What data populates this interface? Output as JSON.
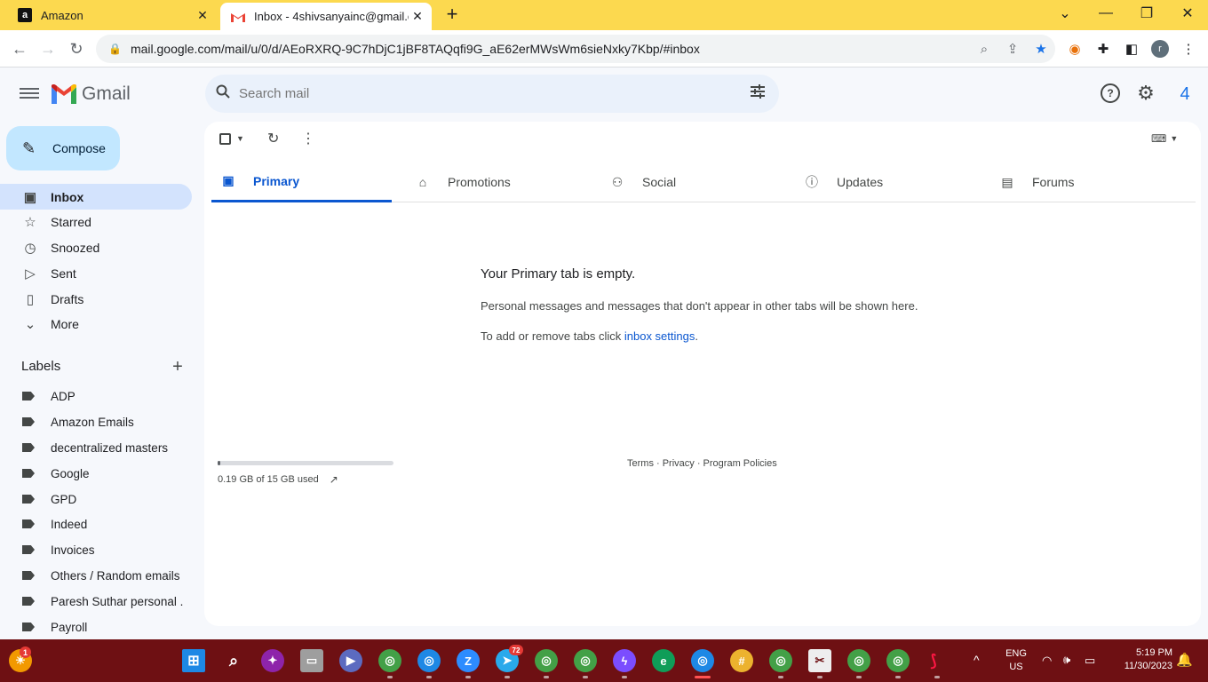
{
  "browser": {
    "tabs": [
      {
        "title": "Amazon",
        "favicon": "a"
      },
      {
        "title": "Inbox - 4shivsanyainc@gmail.co",
        "favicon": "gmail"
      }
    ],
    "url": "mail.google.com/mail/u/0/d/AEoRXRQ-9C7hDjC1jBF8TAQqfi9G_aE62erMWsWm6sieNxky7Kbp/#inbox",
    "profile_initial": "r"
  },
  "gmail": {
    "app_name": "Gmail",
    "search_placeholder": "Search mail",
    "account_initial": "4",
    "compose_label": "Compose",
    "nav": [
      {
        "label": "Inbox",
        "icon": "inbox-icon"
      },
      {
        "label": "Starred",
        "icon": "star-icon"
      },
      {
        "label": "Snoozed",
        "icon": "clock-icon"
      },
      {
        "label": "Sent",
        "icon": "send-icon"
      },
      {
        "label": "Drafts",
        "icon": "draft-icon"
      },
      {
        "label": "More",
        "icon": "chevron-down-icon"
      }
    ],
    "labels_title": "Labels",
    "labels": [
      "ADP",
      "Amazon Emails",
      "decentralized masters",
      "Google",
      "GPD",
      "Indeed",
      "Invoices",
      "Others / Random emails",
      "Paresh Suthar personal ...",
      "Payroll"
    ],
    "tabs": [
      {
        "label": "Primary",
        "icon": "inbox-tab-icon"
      },
      {
        "label": "Promotions",
        "icon": "tag-icon"
      },
      {
        "label": "Social",
        "icon": "people-icon"
      },
      {
        "label": "Updates",
        "icon": "info-icon"
      },
      {
        "label": "Forums",
        "icon": "forum-icon"
      }
    ],
    "empty_title": "Your Primary tab is empty.",
    "empty_desc": "Personal messages and messages that don't appear in other tabs will be shown here.",
    "empty_settings_prefix": "To add or remove tabs click ",
    "empty_settings_link": "inbox settings",
    "empty_settings_suffix": ".",
    "storage_text": "0.19 GB of 15 GB used",
    "storage_used_fraction": 0.013,
    "footer_links": "Terms · Privacy · Program Policies"
  },
  "taskbar": {
    "lang_line1": "ENG",
    "lang_line2": "US",
    "time": "5:19 PM",
    "date": "11/30/2023",
    "telegram_badge": "72",
    "notification_badge": "1"
  },
  "colors": {
    "tabbar_bg": "#fcd94f",
    "taskbar_bg": "#6e1013",
    "accent": "#0b57d0",
    "compose_bg": "#c2e7ff"
  }
}
